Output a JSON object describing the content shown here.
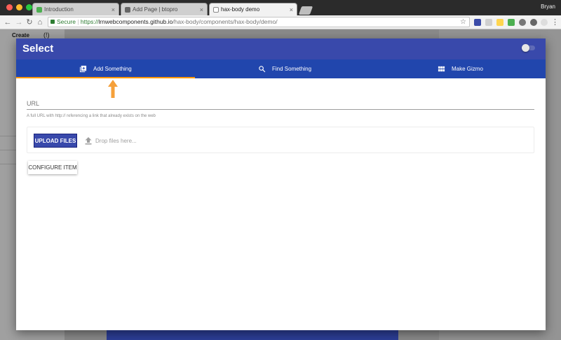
{
  "browser": {
    "tabs": [
      {
        "title": "Introduction",
        "active": false
      },
      {
        "title": "Add Page | btopro",
        "active": false
      },
      {
        "title": "hax-body demo",
        "active": true
      }
    ],
    "close_glyph": "×",
    "user": "Bryan",
    "address": {
      "secure_label": "Secure",
      "separator": "|",
      "scheme": "https://",
      "host": "lrnwebcomponents.github.io",
      "path": "/hax-body/components/hax-body/demo/"
    }
  },
  "background_page": {
    "create_label": "Create",
    "power_glyph": "(!)"
  },
  "modal": {
    "title": "Select",
    "tabs": [
      {
        "label": "Add Something",
        "icon": "add-box-icon"
      },
      {
        "label": "Find Something",
        "icon": "search-icon"
      },
      {
        "label": "Make Gizmo",
        "icon": "view-module-icon"
      }
    ],
    "url_field": {
      "label": "URL",
      "value": "",
      "help": "A full URL with http:// referencing a link that already exists on the web"
    },
    "upload": {
      "button_label": "UPLOAD FILES",
      "drop_text": "Drop files here..."
    },
    "configure_button_label": "CONFIGURE ITEM"
  },
  "colors": {
    "header": "#3949ab",
    "tab_bar": "#2146ad",
    "accent": "#ff9800"
  }
}
